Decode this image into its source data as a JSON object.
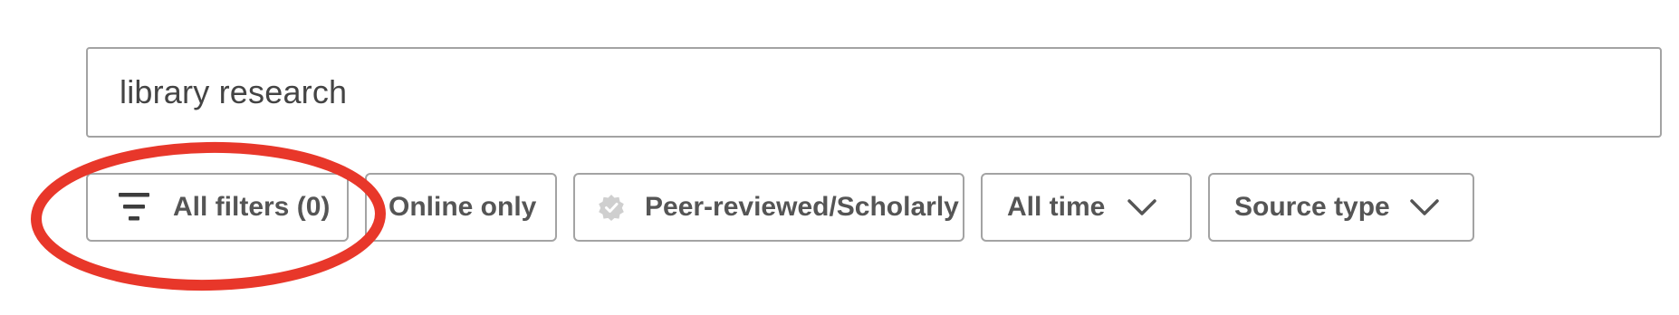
{
  "search": {
    "value": "library research"
  },
  "filters": {
    "all_filters_label": "All filters (0)",
    "online_only_label": "Online only",
    "peer_reviewed_label": "Peer-reviewed/Scholarly",
    "date_range_label": "All time",
    "source_type_label": "Source type"
  },
  "icons": {
    "all_filters": "filter-icon",
    "peer_reviewed": "verified-badge-icon",
    "date_range": "chevron-down-icon",
    "source_type": "chevron-down-icon"
  },
  "colors": {
    "annotation": "#e8372a",
    "border": "#a3a3a3",
    "text": "#555555"
  }
}
